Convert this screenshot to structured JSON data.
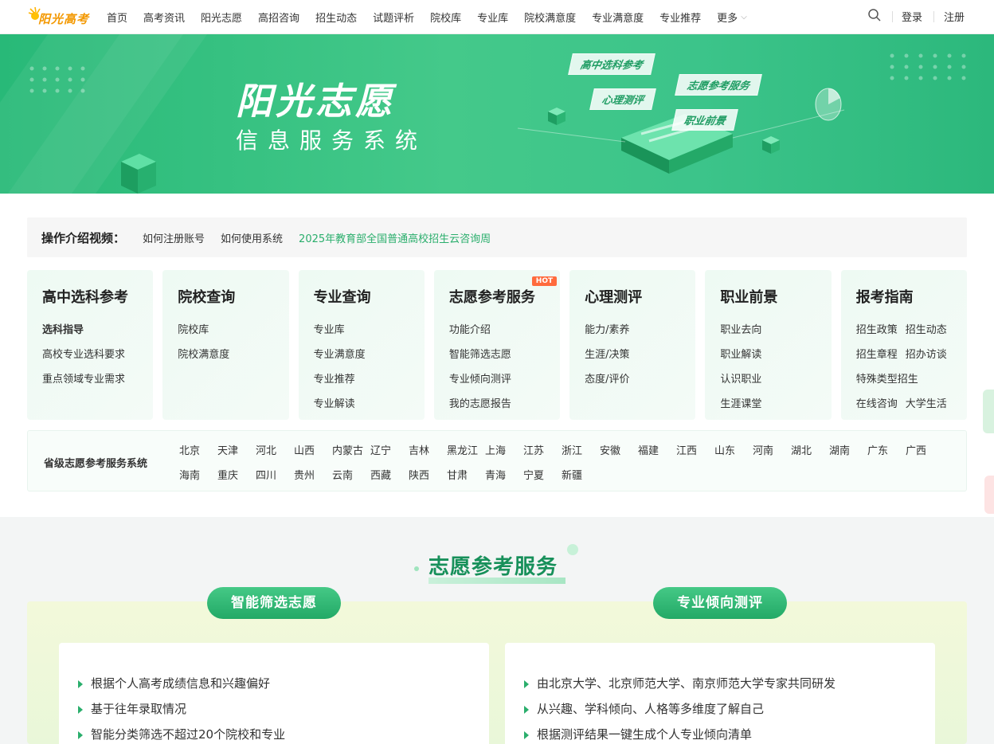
{
  "header": {
    "logo_text": "阳光高考",
    "nav": [
      "首页",
      "高考资讯",
      "阳光志愿",
      "高招咨询",
      "招生动态",
      "试题评析",
      "院校库",
      "专业库",
      "院校满意度",
      "专业满意度",
      "专业推荐"
    ],
    "more": "更多",
    "login": "登录",
    "register": "注册"
  },
  "banner": {
    "title": "阳光志愿",
    "subtitle": "信息服务系统",
    "tags": [
      "高中选科参考",
      "志愿参考服务",
      "心理测评",
      "职业前景"
    ]
  },
  "intro": {
    "title": "操作介绍视频：",
    "links": [
      "如何注册账号",
      "如何使用系统"
    ],
    "highlight": "2025年教育部全国普通高校招生云咨询周"
  },
  "cards": [
    {
      "title": "高中选科参考",
      "links": [
        "选科指导",
        "高校专业选科要求",
        "重点领域专业需求"
      ]
    },
    {
      "title": "院校查询",
      "links": [
        "院校库",
        "院校满意度"
      ]
    },
    {
      "title": "专业查询",
      "links": [
        "专业库",
        "专业满意度",
        "专业推荐",
        "专业解读"
      ]
    },
    {
      "title": "志愿参考服务",
      "hot": "HOT",
      "links": [
        "功能介绍",
        "智能筛选志愿",
        "专业倾向测评",
        "我的志愿报告"
      ]
    },
    {
      "title": "心理测评",
      "links": [
        "能力/素养",
        "生涯/决策",
        "态度/评价"
      ]
    },
    {
      "title": "职业前景",
      "links": [
        "职业去向",
        "职业解读",
        "认识职业",
        "生涯课堂"
      ]
    },
    {
      "title": "报考指南",
      "pairs": [
        [
          "招生政策",
          "招生动态"
        ],
        [
          "招生章程",
          "招办访谈"
        ],
        [
          "特殊类型招生"
        ],
        [
          "在线咨询",
          "大学生活"
        ]
      ]
    }
  ],
  "provinces": {
    "label": "省级志愿参考服务系统",
    "list": [
      "北京",
      "天津",
      "河北",
      "山西",
      "内蒙古",
      "辽宁",
      "吉林",
      "黑龙江",
      "上海",
      "江苏",
      "浙江",
      "安徽",
      "福建",
      "江西",
      "山东",
      "河南",
      "湖北",
      "湖南",
      "广东",
      "广西",
      "海南",
      "重庆",
      "四川",
      "贵州",
      "云南",
      "西藏",
      "陕西",
      "甘肃",
      "青海",
      "宁夏",
      "新疆"
    ]
  },
  "section": {
    "title": "志愿参考服务",
    "left": {
      "pill": "智能筛选志愿",
      "items": [
        "根据个人高考成绩信息和兴趣偏好",
        "基于往年录取情况",
        "智能分类筛选不超过20个院校和专业"
      ]
    },
    "right": {
      "pill": "专业倾向测评",
      "items": [
        "由北京大学、北京师范大学、南京师范大学专家共同研发",
        "从兴趣、学科倾向、人格等多维度了解自己",
        "根据测评结果一键生成个人专业倾向清单"
      ]
    }
  },
  "colors": {
    "brand_green": "#2aae6c",
    "title_green": "#17905a",
    "logo_orange": "#f39800",
    "hot": "#ff6b3d"
  }
}
